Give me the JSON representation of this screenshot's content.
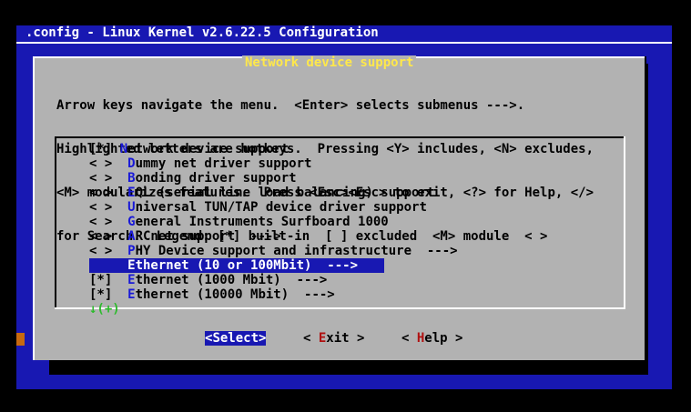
{
  "window": {
    "title": ".config - Linux Kernel v2.6.22.5 Configuration"
  },
  "dialog": {
    "title": "Network device support",
    "instructions": [
      "Arrow keys navigate the menu.  <Enter> selects submenus --->.",
      "Highlighted letters are hotkeys.  Pressing <Y> includes, <N> excludes,",
      "<M> modularizes features.  Press <Esc><Esc> to exit, <?> for Help, </>",
      "for Search.  Legend: [*] built-in  [ ] excluded  <M> module  < >"
    ]
  },
  "menu": {
    "items": [
      {
        "state": "[*]",
        "hotkey": "N",
        "rest": "etwork device support",
        "indent": false,
        "selected": false
      },
      {
        "state": "< >",
        "hotkey": "D",
        "rest": "ummy net driver support",
        "indent": true,
        "selected": false
      },
      {
        "state": "< >",
        "hotkey": "B",
        "rest": "onding driver support",
        "indent": true,
        "selected": false
      },
      {
        "state": "< >",
        "hotkey": "E",
        "rest": "QL (serial line load balancing) support",
        "indent": true,
        "selected": false
      },
      {
        "state": "< >",
        "hotkey": "U",
        "rest": "niversal TUN/TAP device driver support",
        "indent": true,
        "selected": false
      },
      {
        "state": "< >",
        "hotkey": "G",
        "rest": "eneral Instruments Surfboard 1000",
        "indent": true,
        "selected": false
      },
      {
        "state": "< >",
        "hotkey": "A",
        "rest": "RCnet support  --->",
        "indent": true,
        "selected": false
      },
      {
        "state": "< >",
        "hotkey": "P",
        "rest": "HY Device support and infrastructure  --->",
        "indent": true,
        "selected": false
      },
      {
        "state": "",
        "hotkey": "E",
        "rest": "thernet (10 or 100Mbit)  --->",
        "indent": true,
        "selected": true
      },
      {
        "state": "[*]",
        "hotkey": "E",
        "rest": "thernet (1000 Mbit)  --->",
        "indent": true,
        "selected": false
      },
      {
        "state": "[*]",
        "hotkey": "E",
        "rest": "thernet (10000 Mbit)  --->",
        "indent": true,
        "selected": false
      }
    ],
    "more_indicator": "↓(+)"
  },
  "buttons": {
    "select": {
      "prefix": "<",
      "hotkey": "S",
      "rest": "elect>"
    },
    "exit": {
      "prefix": "< ",
      "hotkey": "E",
      "rest": "xit >"
    },
    "help": {
      "prefix": "< ",
      "hotkey": "H",
      "rest": "elp >"
    }
  },
  "colors": {
    "background": "#1818b2",
    "dialog": "#b2b2b2",
    "title_text": "#ffe84a",
    "hotkey": "#1818d8",
    "button_hotkey": "#b01010",
    "more_indicator": "#2dbb2d"
  }
}
